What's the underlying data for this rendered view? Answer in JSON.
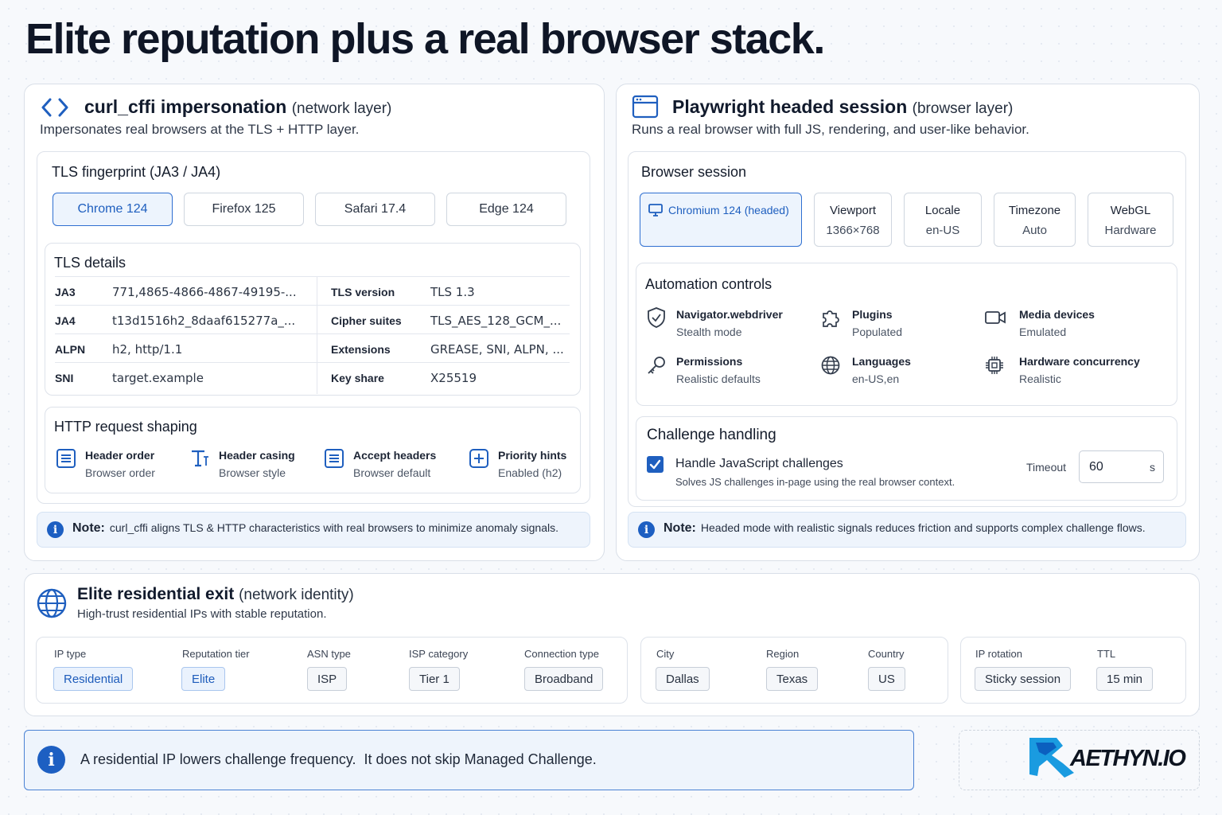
{
  "title": "Elite reputation plus a real browser stack.",
  "colors": {
    "accent": "#1f5fbf",
    "text": "#111a2c",
    "note_bg": "#eef4fc"
  },
  "network": {
    "title": "curl_cffi impersonation",
    "title_paren": "(network layer)",
    "description": "Impersonates real browsers at the TLS + HTTP layer.",
    "icon": "code-brackets-icon",
    "fingerprint": {
      "heading": "TLS fingerprint (JA3 / JA4)",
      "options": [
        "Chrome 124",
        "Firefox 125",
        "Safari 17.4",
        "Edge 124"
      ],
      "selected": "Chrome 124"
    },
    "tls_details": {
      "heading": "TLS details",
      "left": [
        {
          "key": "JA3",
          "value": "771,4865-4866-4867-49195-..."
        },
        {
          "key": "JA4",
          "value": "t13d1516h2_8daaf615277a_..."
        },
        {
          "key": "ALPN",
          "value": "h2, http/1.1"
        },
        {
          "key": "SNI",
          "value": "target.example"
        }
      ],
      "right": [
        {
          "key": "TLS version",
          "value": "TLS 1.3"
        },
        {
          "key": "Cipher suites",
          "value": "TLS_AES_128_GCM_..."
        },
        {
          "key": "Extensions",
          "value": "GREASE, SNI, ALPN, ..."
        },
        {
          "key": "Key share",
          "value": "X25519"
        }
      ]
    },
    "http_shaping": {
      "heading": "HTTP request shaping",
      "items": [
        {
          "title": "Header order",
          "sub": "Browser order",
          "icon": "list-icon"
        },
        {
          "title": "Header casing",
          "sub": "Browser style",
          "icon": "text-casing-icon"
        },
        {
          "title": "Accept headers",
          "sub": "Browser default",
          "icon": "list-icon"
        },
        {
          "title": "Priority hints",
          "sub": "Enabled (h2)",
          "icon": "plus-box-icon"
        }
      ]
    },
    "note_label": "Note:",
    "note": "curl_cffi aligns TLS & HTTP characteristics with real browsers to minimize anomaly signals."
  },
  "browser": {
    "title": "Playwright headed session",
    "title_paren": "(browser layer)",
    "description": "Runs a real browser with full JS, rendering, and user-like behavior.",
    "icon": "browser-window-icon",
    "session": {
      "heading": "Browser session",
      "engine": "Chromium 124 (headed)",
      "settings": [
        {
          "label": "Viewport",
          "value": "1366×768"
        },
        {
          "label": "Locale",
          "value": "en-US"
        },
        {
          "label": "Timezone",
          "value": "Auto"
        },
        {
          "label": "WebGL",
          "value": "Hardware"
        }
      ]
    },
    "automation": {
      "heading": "Automation controls",
      "items": [
        {
          "title": "Navigator.webdriver",
          "sub": "Stealth mode",
          "icon": "shield-check-icon"
        },
        {
          "title": "Plugins",
          "sub": "Populated",
          "icon": "puzzle-icon"
        },
        {
          "title": "Media devices",
          "sub": "Emulated",
          "icon": "camera-icon"
        },
        {
          "title": "Permissions",
          "sub": "Realistic defaults",
          "icon": "key-icon"
        },
        {
          "title": "Languages",
          "sub": "en-US,en",
          "icon": "globe-icon"
        },
        {
          "title": "Hardware concurrency",
          "sub": "Realistic",
          "icon": "cpu-chip-icon"
        }
      ]
    },
    "challenge": {
      "heading": "Challenge handling",
      "checkbox_label": "Handle JavaScript challenges",
      "checkbox_checked": true,
      "checkbox_sub": "Solves JS challenges in-page using the real browser context.",
      "timeout_label": "Timeout",
      "timeout_value": "60",
      "timeout_unit": "s"
    },
    "note_label": "Note:",
    "note": "Headed mode with realistic signals reduces friction and supports complex challenge flows."
  },
  "residential": {
    "title": "Elite residential exit",
    "title_paren": "(network identity)",
    "description": "High-trust residential IPs with stable reputation.",
    "icon": "globe-icon",
    "fields_group1": [
      {
        "label": "IP type",
        "value": "Residential",
        "highlight": true
      },
      {
        "label": "Reputation tier",
        "value": "Elite",
        "highlight": true
      },
      {
        "label": "ASN type",
        "value": "ISP",
        "highlight": false
      },
      {
        "label": "ISP category",
        "value": "Tier 1",
        "highlight": false
      },
      {
        "label": "Connection type",
        "value": "Broadband",
        "highlight": false
      }
    ],
    "fields_group2": [
      {
        "label": "City",
        "value": "Dallas"
      },
      {
        "label": "Region",
        "value": "Texas"
      },
      {
        "label": "Country",
        "value": "US"
      }
    ],
    "fields_group3": [
      {
        "label": "IP rotation",
        "value": "Sticky session"
      },
      {
        "label": "TTL",
        "value": "15 min"
      }
    ]
  },
  "bottom_note": "A residential IP lowers challenge frequency.  It does not skip Managed Challenge.",
  "logo_text": "AETHYN.IO"
}
